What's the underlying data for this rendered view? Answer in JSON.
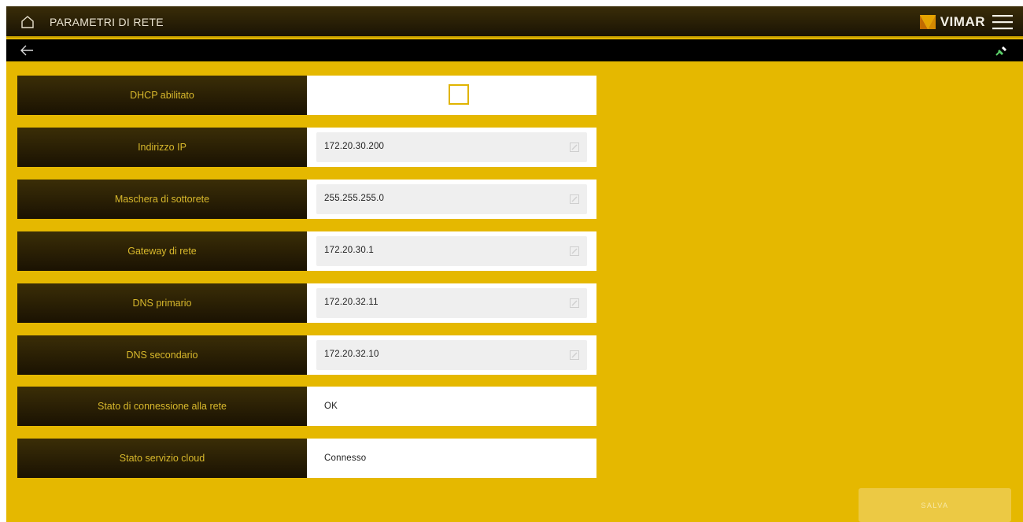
{
  "header": {
    "title": "PARAMETRI DI RETE",
    "brand": "VIMAR",
    "icons": [
      "home-icon",
      "vimar-logo-icon",
      "menu-icon"
    ]
  },
  "subbar": {
    "icons": [
      "back-arrow-icon",
      "connection-plug-icon"
    ]
  },
  "rows": {
    "dhcp": {
      "label": "DHCP abilitato",
      "checked": false
    },
    "ip": {
      "label": "Indirizzo IP",
      "value": "172.20.30.200"
    },
    "mask": {
      "label": "Maschera di sottorete",
      "value": "255.255.255.0"
    },
    "gateway": {
      "label": "Gateway di rete",
      "value": "172.20.30.1"
    },
    "dns1": {
      "label": "DNS primario",
      "value": "172.20.32.11"
    },
    "dns2": {
      "label": "DNS secondario",
      "value": "172.20.32.10"
    },
    "net_status": {
      "label": "Stato di connessione alla rete",
      "value": "OK"
    },
    "cloud_status": {
      "label": "Stato servizio cloud",
      "value": "Connesso"
    }
  },
  "footer": {
    "save_label": "SALVA"
  },
  "colors": {
    "background": "#e5b800",
    "header_dark": "#1a1304",
    "label_text": "#d8b82c",
    "accent": "#e0b400"
  }
}
